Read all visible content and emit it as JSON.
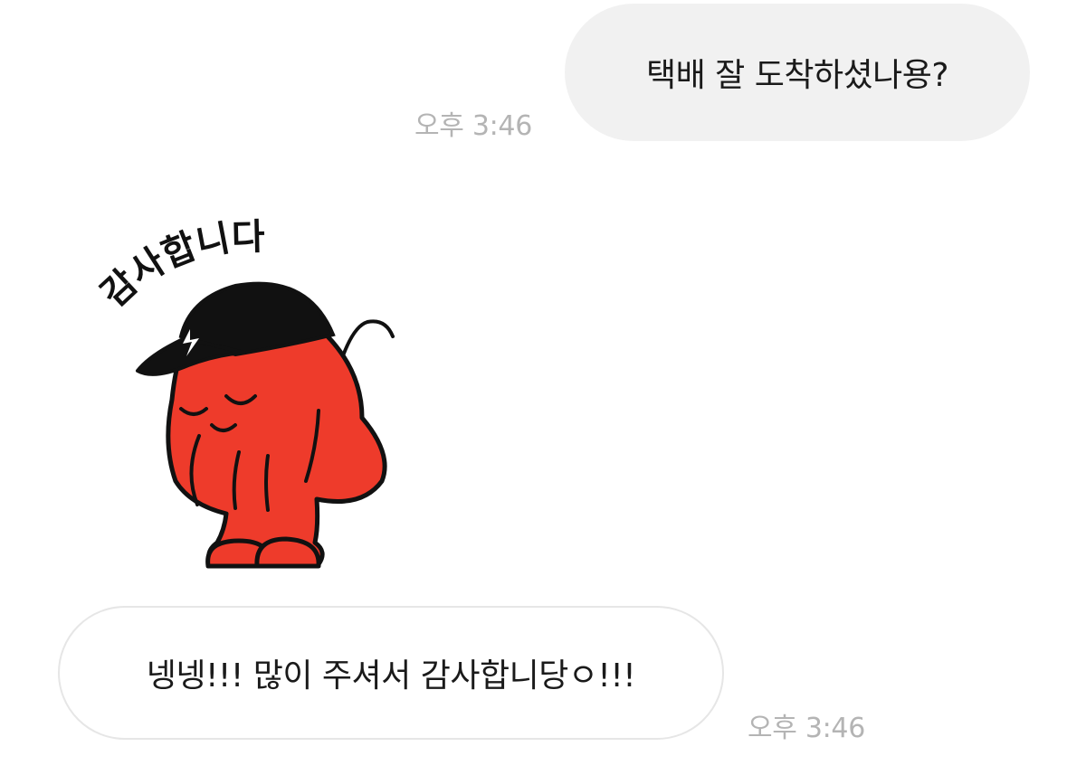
{
  "messages": {
    "outgoing": {
      "text": "택배 잘 도착하셨나용?",
      "time": "오후 3:46"
    },
    "sticker": {
      "caption": "감사합니다",
      "icon": "bowing-red-character-sticker",
      "colors": {
        "body": "#ee3b2b",
        "cap": "#111111"
      }
    },
    "incoming": {
      "text": "넹넹!!! 많이 주셔서 감사합니당ㅇ!!!",
      "time": "오후 3:46"
    }
  },
  "colors": {
    "outgoing_bubble": "#f1f1f1",
    "incoming_bubble_border": "#e6e6e6",
    "timestamp": "#b4b4b4"
  }
}
